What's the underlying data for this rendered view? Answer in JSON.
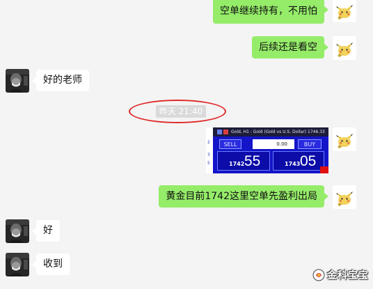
{
  "colors": {
    "background": "#f4f4f4",
    "bubble_self": "#95ec69",
    "bubble_other": "#ffffff",
    "timestamp_bg": "#dadada",
    "highlight_circle": "#e02a2a"
  },
  "messages": [
    {
      "side": "right",
      "text": "空单继续持有，不用怕"
    },
    {
      "side": "right",
      "text": "后续还是看空"
    },
    {
      "side": "left",
      "text": "好的老师"
    },
    {
      "side": "right",
      "text": "黄金目前1742这里空单先盈利出局"
    },
    {
      "side": "left",
      "text": "好"
    },
    {
      "side": "left",
      "text": "收到"
    }
  ],
  "timestamp": "昨天 21:40",
  "trade_widget": {
    "title": "Gold, H1 : Gold (Gold vs U.S. Dollar)  1746.33",
    "side_numbers": [
      "2",
      "3",
      "5"
    ],
    "sell_label": "SELL",
    "buy_label": "BUY",
    "lot": "0.00",
    "sell_prefix": "1742",
    "sell_big": "55",
    "buy_prefix": "1743",
    "buy_big": "05"
  },
  "icons": {
    "self_avatar": "cartoon-avatar-icon",
    "other_avatar": "photo-avatar",
    "watermark_logo": "logo-icon"
  },
  "watermark": "金科宝宝"
}
